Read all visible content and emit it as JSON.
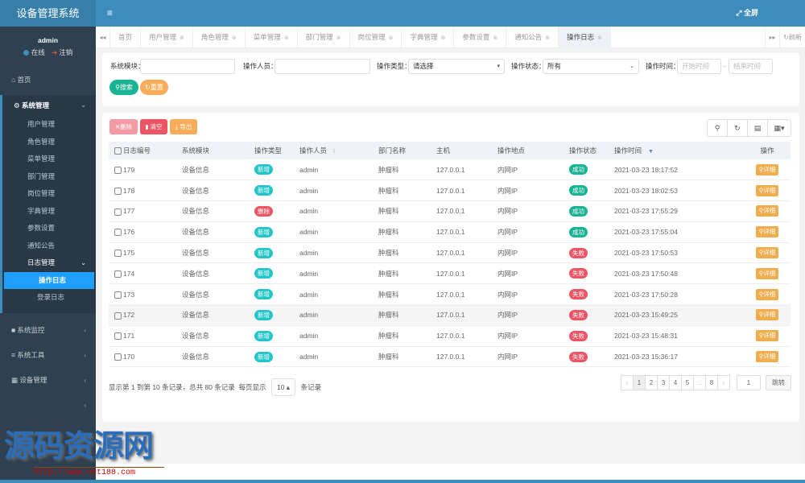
{
  "app": {
    "title": "设备管理系统",
    "fullscreen_label": "全屏"
  },
  "user": {
    "name": "admin",
    "online_label": "在线",
    "logout_label": "注销"
  },
  "sidebar": {
    "home": "首页",
    "system": {
      "label": "系统管理",
      "items": [
        "用户管理",
        "角色管理",
        "菜单管理",
        "部门管理",
        "岗位管理",
        "字典管理",
        "参数设置",
        "通知公告"
      ],
      "log_group": {
        "label": "日志管理",
        "items": [
          "操作日志",
          "登录日志"
        ],
        "active": "操作日志"
      }
    },
    "other_groups": [
      "系统监控",
      "系统工具",
      "设备管理",
      ""
    ]
  },
  "tabs": {
    "items": [
      "首页",
      "用户管理",
      "角色管理",
      "菜单管理",
      "部门管理",
      "岗位管理",
      "字典管理",
      "参数设置",
      "通知公告",
      "操作日志"
    ],
    "active": "操作日志",
    "refresh_label": "刷新"
  },
  "search": {
    "module_label": "系统模块：",
    "module_value": "",
    "operator_label": "操作人员：",
    "operator_value": "",
    "type_label": "操作类型：",
    "type_value": "请选择",
    "status_label": "操作状态：",
    "status_value": "所有",
    "time_label": "操作时间：",
    "start_placeholder": "开始时间",
    "end_placeholder": "结束时间",
    "separator": "-",
    "search_button": "搜索",
    "reset_button": "重置"
  },
  "toolbar": {
    "delete": "删除",
    "clear": "清空",
    "export": "导出"
  },
  "table": {
    "columns": [
      "日志编号",
      "系统模块",
      "操作类型",
      "操作人员",
      "部门名称",
      "主机",
      "操作地点",
      "操作状态",
      "操作时间",
      "操作"
    ],
    "detail_label": "详细",
    "colors": {
      "add": "#23c6c8",
      "delete": "#ed5565",
      "success": "#1ab394",
      "fail": "#ed5565"
    },
    "rows": [
      {
        "id": "179",
        "module": "设备信息",
        "type": "新增",
        "type_kind": "add",
        "operator": "admin",
        "dept": "肿瘤科",
        "host": "127.0.0.1",
        "location": "内网IP",
        "status": "成功",
        "status_kind": "success",
        "time": "2021-03-23 18:17:52"
      },
      {
        "id": "178",
        "module": "设备信息",
        "type": "新增",
        "type_kind": "add",
        "operator": "admin",
        "dept": "肿瘤科",
        "host": "127.0.0.1",
        "location": "内网IP",
        "status": "成功",
        "status_kind": "success",
        "time": "2021-03-23 18:02:53"
      },
      {
        "id": "177",
        "module": "设备信息",
        "type": "删除",
        "type_kind": "delete",
        "operator": "admin",
        "dept": "肿瘤科",
        "host": "127.0.0.1",
        "location": "内网IP",
        "status": "成功",
        "status_kind": "success",
        "time": "2021-03-23 17:55:29"
      },
      {
        "id": "176",
        "module": "设备信息",
        "type": "新增",
        "type_kind": "add",
        "operator": "admin",
        "dept": "肿瘤科",
        "host": "127.0.0.1",
        "location": "内网IP",
        "status": "成功",
        "status_kind": "success",
        "time": "2021-03-23 17:55:04"
      },
      {
        "id": "175",
        "module": "设备信息",
        "type": "新增",
        "type_kind": "add",
        "operator": "admin",
        "dept": "肿瘤科",
        "host": "127.0.0.1",
        "location": "内网IP",
        "status": "失败",
        "status_kind": "fail",
        "time": "2021-03-23 17:50:53"
      },
      {
        "id": "174",
        "module": "设备信息",
        "type": "新增",
        "type_kind": "add",
        "operator": "admin",
        "dept": "肿瘤科",
        "host": "127.0.0.1",
        "location": "内网IP",
        "status": "失败",
        "status_kind": "fail",
        "time": "2021-03-23 17:50:48"
      },
      {
        "id": "173",
        "module": "设备信息",
        "type": "新增",
        "type_kind": "add",
        "operator": "admin",
        "dept": "肿瘤科",
        "host": "127.0.0.1",
        "location": "内网IP",
        "status": "失败",
        "status_kind": "fail",
        "time": "2021-03-23 17:50:28"
      },
      {
        "id": "172",
        "module": "设备信息",
        "type": "新增",
        "type_kind": "add",
        "operator": "admin",
        "dept": "肿瘤科",
        "host": "127.0.0.1",
        "location": "内网IP",
        "status": "失败",
        "status_kind": "fail",
        "time": "2021-03-23 15:49:25",
        "highlight": true
      },
      {
        "id": "171",
        "module": "设备信息",
        "type": "新增",
        "type_kind": "add",
        "operator": "admin",
        "dept": "肿瘤科",
        "host": "127.0.0.1",
        "location": "内网IP",
        "status": "失败",
        "status_kind": "fail",
        "time": "2021-03-23 15:48:31"
      },
      {
        "id": "170",
        "module": "设备信息",
        "type": "新增",
        "type_kind": "add",
        "operator": "admin",
        "dept": "肿瘤科",
        "host": "127.0.0.1",
        "location": "内网IP",
        "status": "失败",
        "status_kind": "fail",
        "time": "2021-03-23 15:36:17"
      }
    ]
  },
  "pagination": {
    "info": "显示第 1 到第 10 条记录，总共 80 条记录",
    "per_page_label": "每页显示",
    "per_page_value": "10",
    "per_page_suffix": "条记录",
    "pages": [
      "‹",
      "1",
      "2",
      "3",
      "4",
      "5",
      "...",
      "8",
      "›"
    ],
    "current": "1",
    "jump_value": "1",
    "jump_label": "跳转"
  },
  "watermark": {
    "text": "源码资源网",
    "url": "http://www.net188.com"
  }
}
